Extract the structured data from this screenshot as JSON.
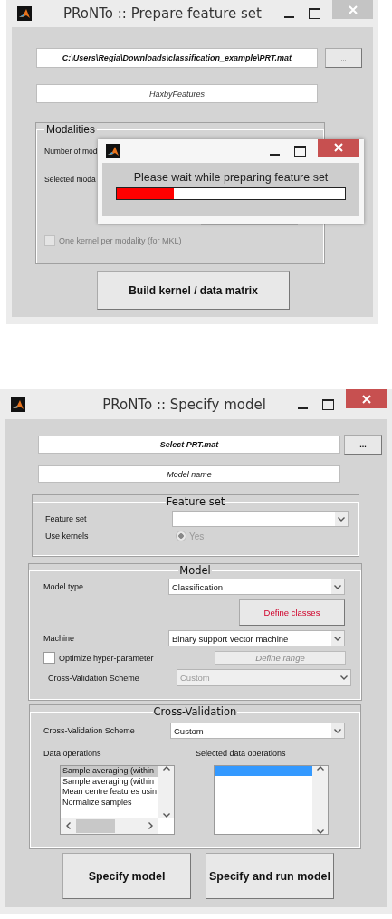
{
  "prepare_window": {
    "title": "PRoNTo :: Prepare feature set",
    "active": false,
    "file_path": "C:\\Users\\Regia\\Downloads\\classification_example\\PRT.mat",
    "browse_button": "...",
    "feature_set_name": "HaxbyFeatures",
    "modalities": {
      "legend": "Modalities",
      "number_label": "Number of mod",
      "selected_label": "Selected moda",
      "one_kernel": {
        "label": "One kernel per modality (for MKL)",
        "checked": false,
        "disabled": true
      }
    },
    "build_button": "Build kernel / data matrix",
    "progress_dialog": {
      "active": true,
      "message": "Please wait while preparing feature set",
      "level": 0.25
    }
  },
  "specify_window": {
    "title": "PRoNTo :: Specify model",
    "active": true,
    "prt_field": "Select PRT.mat",
    "browse_button": "...",
    "model_name": "Model name",
    "feature_set_panel": {
      "legend": "Feature set",
      "feature_set_label": "Feature set",
      "use_kernels_label": "Use kernels",
      "use_kernels": {
        "label": "Yes",
        "selected": true,
        "disabled": true
      }
    },
    "model_panel": {
      "legend": "Model",
      "model_type_label": "Model type",
      "model_type": "Classification",
      "define_classes_button": "Define classes",
      "machine_label": "Machine",
      "machine": "Binary support vector machine",
      "optimize": {
        "label": "Optimize hyper-parameter",
        "checked": false
      },
      "define_range_button": {
        "label": "Define range",
        "disabled": true
      },
      "cv_scheme_label": "Cross-Validation Scheme",
      "cv_scheme": {
        "value": "Custom",
        "disabled": true
      }
    },
    "cv_panel": {
      "legend": "Cross-Validation",
      "scheme_label": "Cross-Validation Scheme",
      "scheme": "Custom",
      "data_operations_label": "Data operations",
      "data_operations": [
        {
          "text": "Sample averaging (within",
          "selected": true
        },
        {
          "text": "Sample averaging (within",
          "selected": false
        },
        {
          "text": "Mean centre features usin",
          "selected": false
        },
        {
          "text": "Normalize samples",
          "selected": false
        }
      ],
      "selected_operations_label": "Selected data operations",
      "selected_operations_highlight": true
    },
    "buttons": [
      "Specify model",
      "Specify and run model"
    ]
  }
}
